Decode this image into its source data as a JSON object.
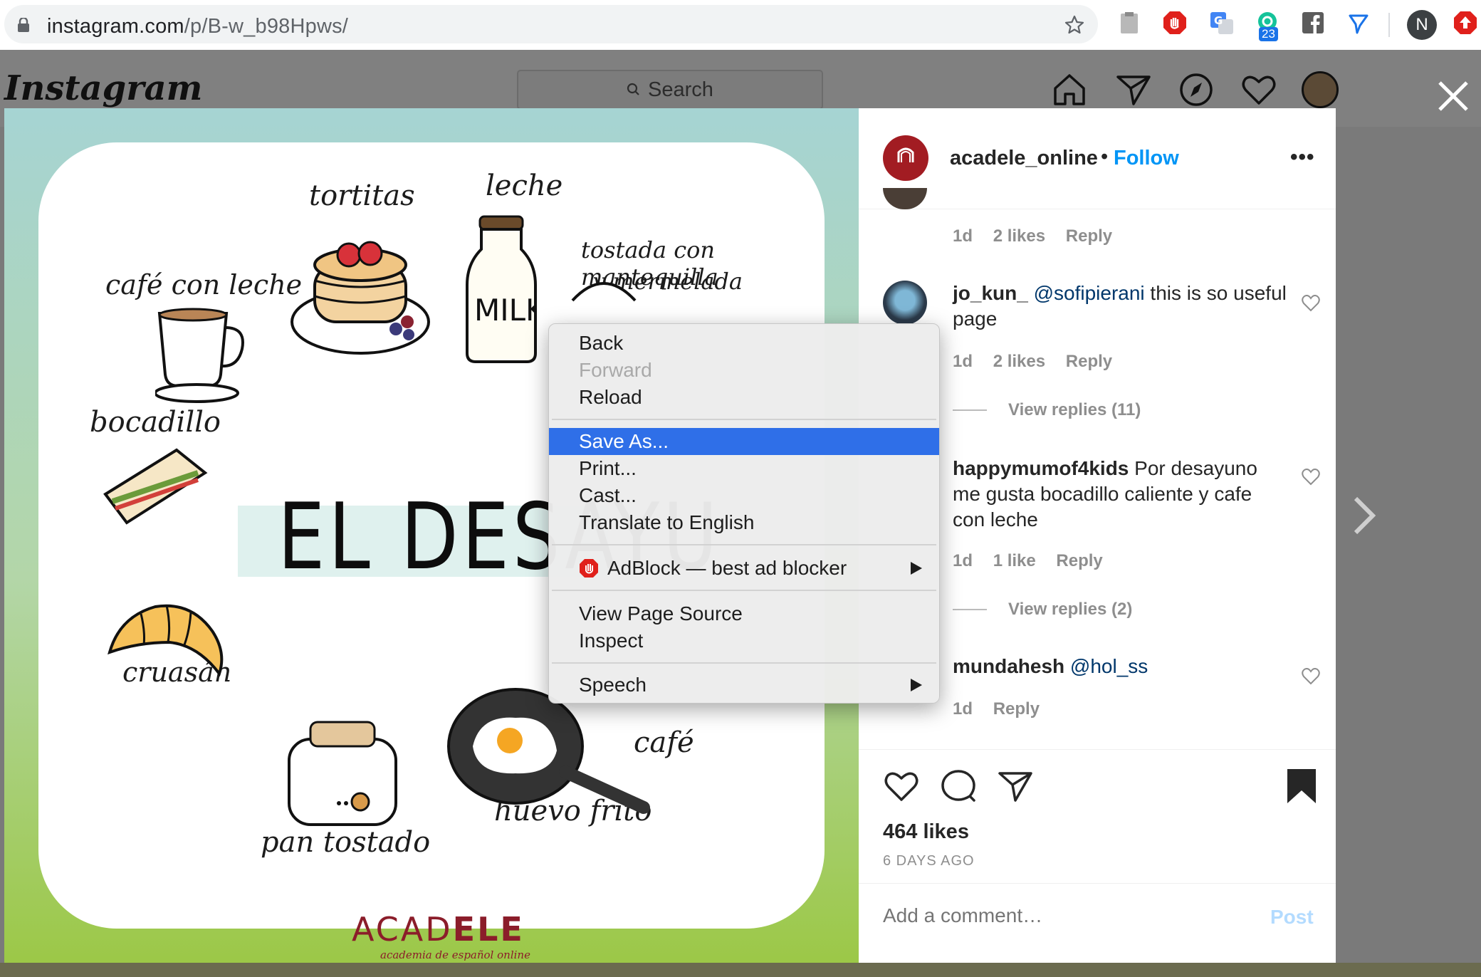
{
  "browser": {
    "url_host": "instagram.com",
    "url_path": "/p/B-w_b98Hpws/",
    "extension_badge": "23",
    "profile_initial": "N"
  },
  "instagram": {
    "logo": "Instagram",
    "search_placeholder": "Search"
  },
  "post_image": {
    "labels": {
      "tortitas": "tortitas",
      "leche": "leche",
      "tostada": "tostada con mantequilla",
      "tostada2": "y mermelada",
      "cafe_con_leche": "café con leche",
      "bocadillo": "bocadillo",
      "cruasan": "cruasán",
      "pan_tostado": "pan tostado",
      "huevo_frito": "huevo frito",
      "cafe": "café",
      "milk": "MILK"
    },
    "title": "EL DESAYU",
    "brand_light": "ACAD",
    "brand_bold": "ELE",
    "brand_sub": "academia de español online"
  },
  "panel": {
    "account": "acadele_online",
    "separator": "•",
    "follow": "Follow",
    "more": "•••",
    "comments": [
      {
        "time": "1d",
        "likes": "2 likes",
        "reply": "Reply"
      },
      {
        "user": "jo_kun_",
        "mention": "@sofipierani",
        "text": " this is so useful page",
        "time": "1d",
        "likes": "2 likes",
        "reply": "Reply",
        "view_replies": "View replies (11)"
      },
      {
        "user": "happymumof4kids",
        "text": " Por desayuno me gusta bocadillo caliente y cafe con leche",
        "time": "1d",
        "likes": "1 like",
        "reply": "Reply",
        "view_replies": "View replies (2)"
      },
      {
        "user": "mundahesh",
        "mention": "@hol_ss",
        "time": "1d",
        "reply": "Reply"
      }
    ],
    "likes": "464 likes",
    "days_ago": "6 DAYS AGO",
    "comment_placeholder": "Add a comment…",
    "post_label": "Post"
  },
  "context_menu": {
    "items": [
      {
        "label": "Back"
      },
      {
        "label": "Forward"
      },
      {
        "label": "Reload"
      },
      {
        "label": "Save As..."
      },
      {
        "label": "Print..."
      },
      {
        "label": "Cast..."
      },
      {
        "label": "Translate to English"
      },
      {
        "label": "AdBlock — best ad blocker"
      },
      {
        "label": "View Page Source"
      },
      {
        "label": "Inspect"
      },
      {
        "label": "Speech"
      }
    ]
  },
  "colors": {
    "accent": "#0095f6",
    "selection": "#2f6fe8",
    "brand": "#8b1d2a"
  }
}
